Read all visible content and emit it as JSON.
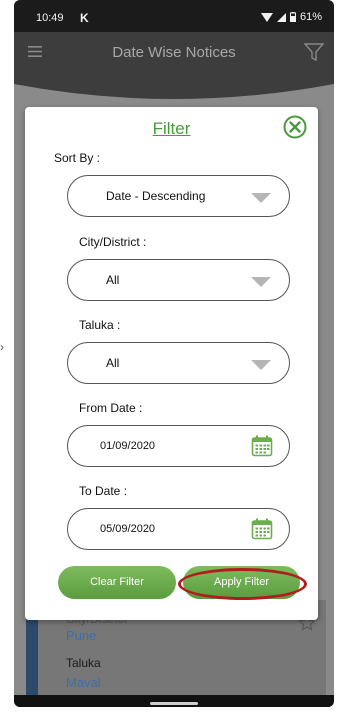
{
  "status_bar": {
    "time": "10:49",
    "app_badge": "K",
    "battery": "61%"
  },
  "app_bar": {
    "title": "Date Wise Notices"
  },
  "background_card": {
    "city_label": "City/District",
    "city_value": "Pune",
    "taluka_label": "Taluka",
    "taluka_value": "Maval"
  },
  "filter_dialog": {
    "title": "Filter",
    "sort_by": {
      "label": "Sort By :",
      "value": "Date - Descending"
    },
    "city_district": {
      "label": "City/District :",
      "value": "All"
    },
    "taluka": {
      "label": "Taluka :",
      "value": "All"
    },
    "from_date": {
      "label": "From Date :",
      "value": "01/09/2020"
    },
    "to_date": {
      "label": "To Date :",
      "value": "05/09/2020"
    },
    "clear_button": "Clear Filter",
    "apply_button": "Apply Filter"
  },
  "colors": {
    "accent_green": "#4a9a3c",
    "highlight_red": "#b31c1c",
    "link_blue": "#3b6fa5"
  },
  "icons": [
    "menu-icon",
    "funnel-filter-icon",
    "close-circle-icon",
    "dropdown-arrow-icon",
    "calendar-icon",
    "star-outline-icon"
  ]
}
